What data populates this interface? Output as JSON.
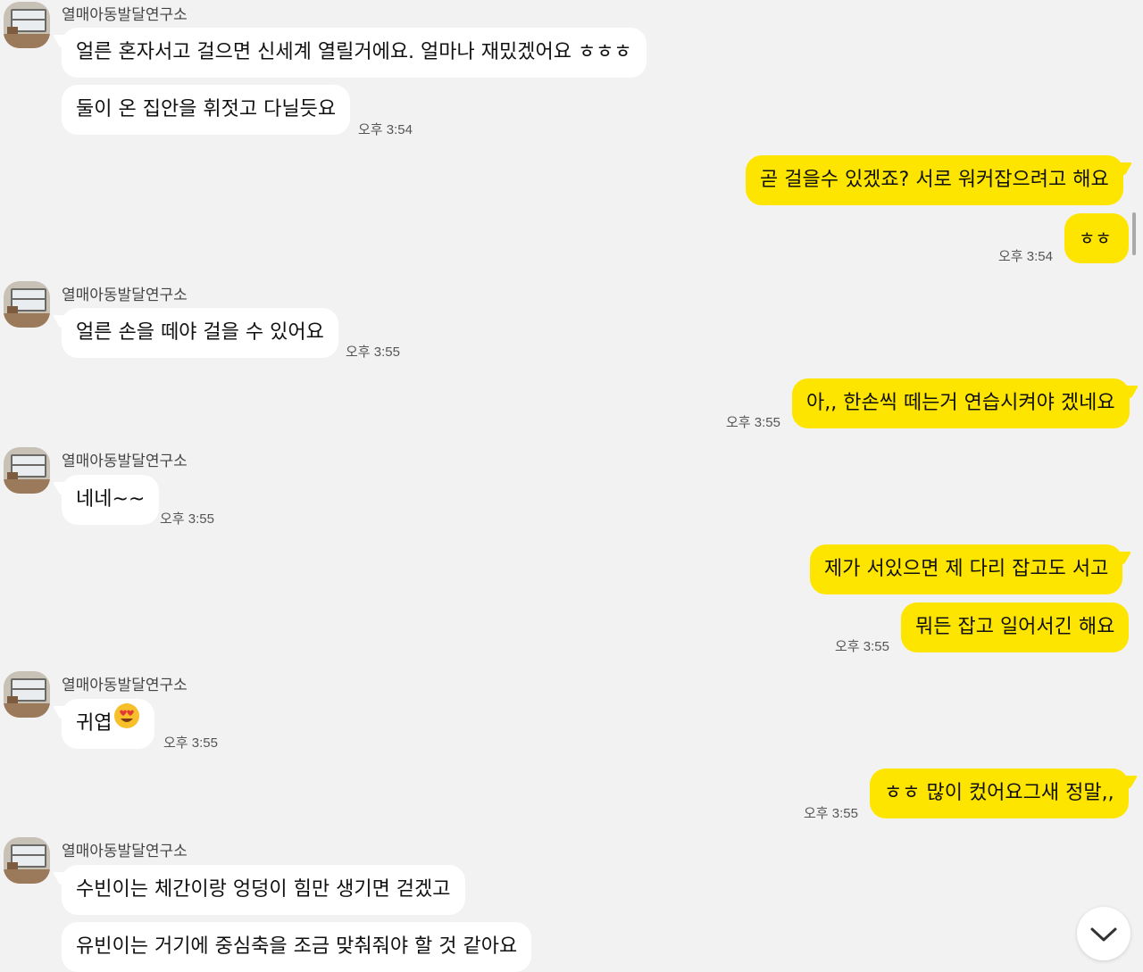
{
  "chat": {
    "partner_name": "열매아동발달연구소",
    "messages": {
      "m1": "얼른 혼자서고 걸으면 신세계 열릴거에요. 얼마나 재밌겠어요 ㅎㅎㅎ",
      "m2": "둘이 온 집안을 휘젓고 다닐듯요",
      "t2": "오후 3:54",
      "m3": "곧 걸을수 있겠죠? 서로 워커잡으려고 해요",
      "m4": "ㅎㅎ",
      "t4": "오후 3:54",
      "m5": "얼른 손을 떼야 걸을 수 있어요",
      "t5": "오후 3:55",
      "m6": "아,, 한손씩 떼는거 연습시켜야 겠네요",
      "t6": "오후 3:55",
      "m7": "네네~~",
      "t7": "오후 3:55",
      "m8": "제가 서있으면 제 다리 잡고도 서고",
      "m9": "뭐든 잡고 일어서긴 해요",
      "t9": "오후 3:55",
      "m10": "귀엽",
      "t10": "오후 3:55",
      "m11": "ㅎㅎ 많이 컸어요그새 정말,,",
      "t11": "오후 3:55",
      "m12": "수빈이는 체간이랑 엉덩이 힘만 생기면 걷겠고",
      "m13": "유빈이는 거기에 중심축을 조금 맞춰줘야 할 것 같아요"
    },
    "icons": {
      "avatar": "profile-photo",
      "emoji": "heart-eyes-emoji",
      "scroll": "chevron-down-icon"
    },
    "colors": {
      "background": "#f2f2f2",
      "incoming_bubble": "#ffffff",
      "outgoing_bubble": "#fee500"
    }
  }
}
